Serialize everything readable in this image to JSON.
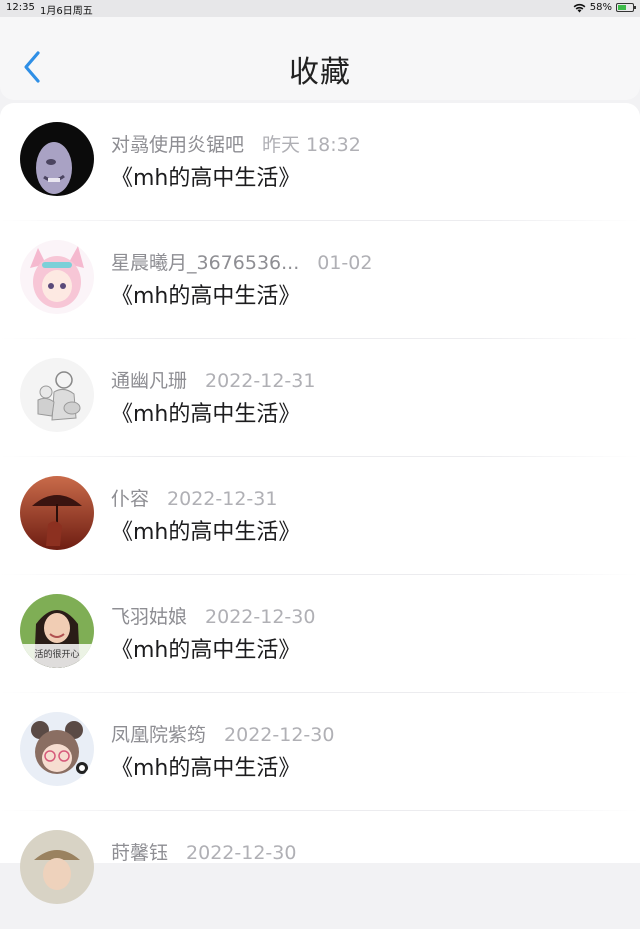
{
  "status": {
    "time": "12:35",
    "date": "1月6日周五",
    "battery": "58%",
    "battery_level": 0.58
  },
  "header": {
    "title": "收藏"
  },
  "items": [
    {
      "user": "对骉使用炎锯吧",
      "date": "昨天 18:32",
      "book": "《mh的高中生活》"
    },
    {
      "user": "星晨曦月_3676536...",
      "date": "01-02",
      "book": "《mh的高中生活》"
    },
    {
      "user": "通幽凡珊",
      "date": "2022-12-31",
      "book": "《mh的高中生活》"
    },
    {
      "user": "仆容",
      "date": "2022-12-31",
      "book": "《mh的高中生活》"
    },
    {
      "user": "飞羽姑娘",
      "date": "2022-12-30",
      "book": "《mh的高中生活》",
      "avatar_caption": "活的很开心"
    },
    {
      "user": "凤凰院紫筠",
      "date": "2022-12-30",
      "book": "《mh的高中生活》"
    },
    {
      "user": "莳馨钰",
      "date": "2022-12-30",
      "book": ""
    }
  ],
  "colors": {
    "accent": "#2f8fe6",
    "title_text": "#222222",
    "meta_text": "#8e8e93",
    "date_text": "#b0b0b5",
    "body_text": "#1c1c1e"
  },
  "icons": {
    "back": "chevron-left-icon",
    "wifi": "wifi-icon",
    "battery": "battery-charging-icon"
  }
}
